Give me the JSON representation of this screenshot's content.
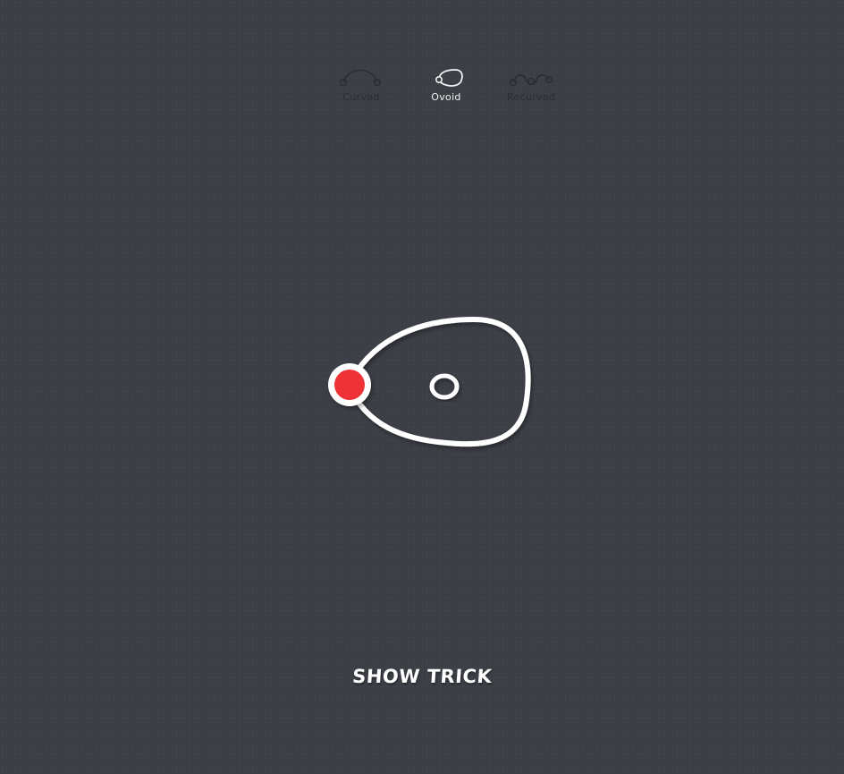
{
  "modes": [
    {
      "id": "curved",
      "label": "Curved",
      "icon": "curved-path-icon",
      "active": false
    },
    {
      "id": "ovoid",
      "label": "Ovoid",
      "icon": "ovoid-loop-icon",
      "active": true
    },
    {
      "id": "recurved",
      "label": "Recurved",
      "icon": "recurved-path-icon",
      "active": false
    }
  ],
  "action": {
    "label": "SHOW TRICK"
  },
  "colors": {
    "background": "#3c3f46",
    "stroke": "#ffffff",
    "handle_fill": "#ee3236",
    "inactive_icon": "#2b2d32"
  }
}
